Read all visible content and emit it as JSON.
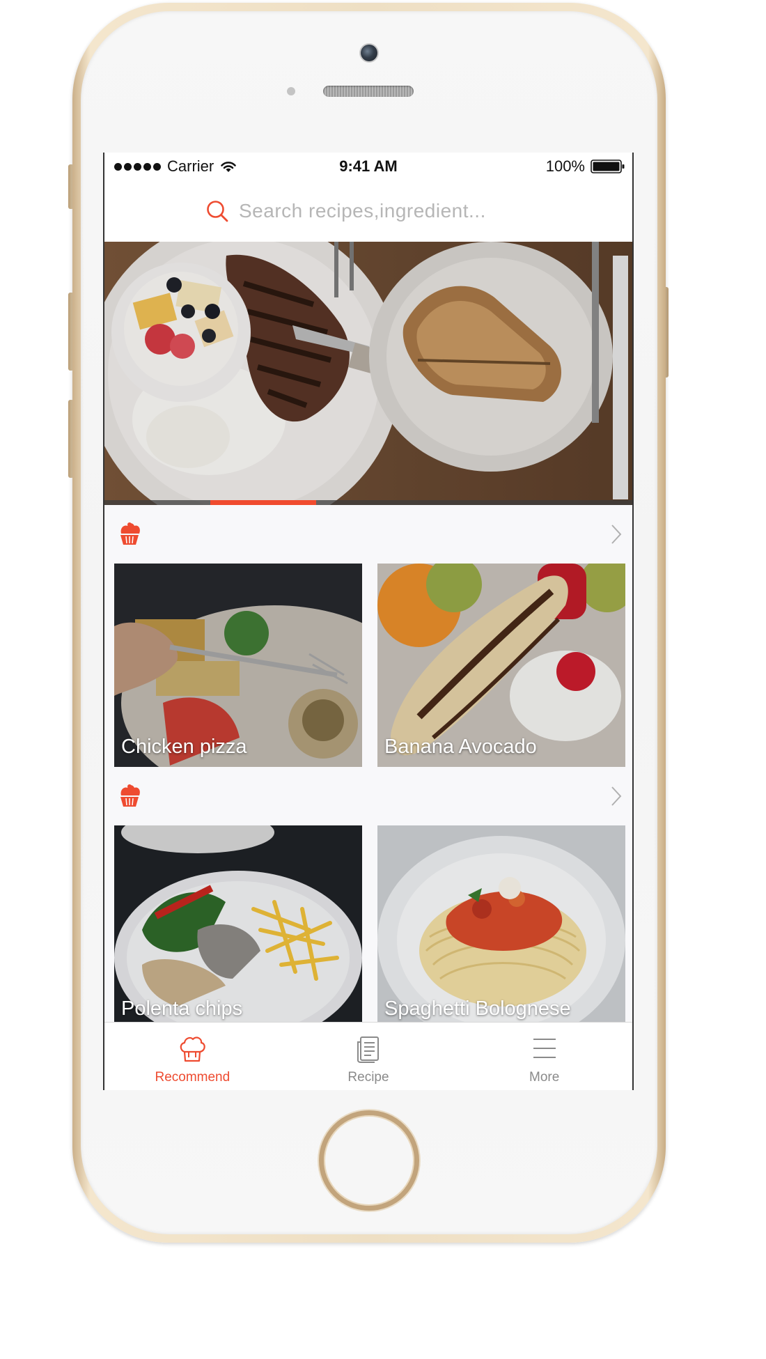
{
  "status_bar": {
    "carrier": "Carrier",
    "time": "9:41 AM",
    "battery": "100%"
  },
  "search": {
    "placeholder": "Search recipes,ingredient..."
  },
  "hero": {
    "slide_count": 5,
    "active_slide": 2
  },
  "sections": [
    {
      "icon": "cupcake-icon",
      "cards": [
        {
          "title": "Chicken pizza"
        },
        {
          "title": "Banana Avocado"
        }
      ]
    },
    {
      "icon": "cupcake-icon",
      "cards": [
        {
          "title": "Polenta chips"
        },
        {
          "title": "Spaghetti Bolognese"
        }
      ]
    }
  ],
  "tab_bar": {
    "tabs": [
      {
        "label": "Recommend",
        "icon": "chef-hat-icon",
        "active": true
      },
      {
        "label": "Recipe",
        "icon": "recipe-book-icon",
        "active": false
      },
      {
        "label": "More",
        "icon": "menu-icon",
        "active": false
      }
    ]
  },
  "colors": {
    "accent": "#ee4b30",
    "tab_inactive": "#8a8a8a",
    "placeholder": "#b6b6b6"
  }
}
